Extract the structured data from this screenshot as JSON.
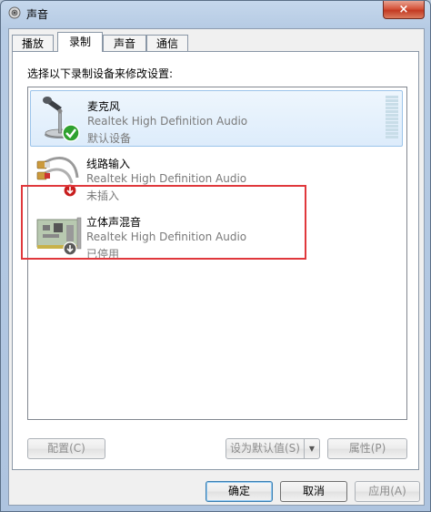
{
  "window": {
    "title": "声音",
    "close_label": "×"
  },
  "tabs": [
    {
      "label": "播放"
    },
    {
      "label": "录制",
      "active": true
    },
    {
      "label": "声音"
    },
    {
      "label": "通信"
    }
  ],
  "instruction": "选择以下录制设备来修改设置:",
  "devices": [
    {
      "name": "麦克风",
      "driver": "Realtek High Definition Audio",
      "status": "默认设备",
      "icon": "microphone-icon",
      "badge": "default-checkmark-icon",
      "selected": true
    },
    {
      "name": "线路输入",
      "driver": "Realtek High Definition Audio",
      "status": "未插入",
      "icon": "line-in-cable-icon",
      "badge": "unplugged-badge-icon"
    },
    {
      "name": "立体声混音",
      "driver": "Realtek High Definition Audio",
      "status": "已停用",
      "icon": "sound-card-icon",
      "badge": "disabled-badge-icon"
    }
  ],
  "buttons": {
    "configure": "配置(C)",
    "set_default": "设为默认值(S)",
    "properties": "属性(P)",
    "ok": "确定",
    "cancel": "取消",
    "apply": "应用(A)"
  },
  "colors": {
    "highlight_border": "#e0383c",
    "selection_bg": "#ddecfb",
    "default_check": "#2fa12f",
    "status_red": "#c81e1e"
  }
}
